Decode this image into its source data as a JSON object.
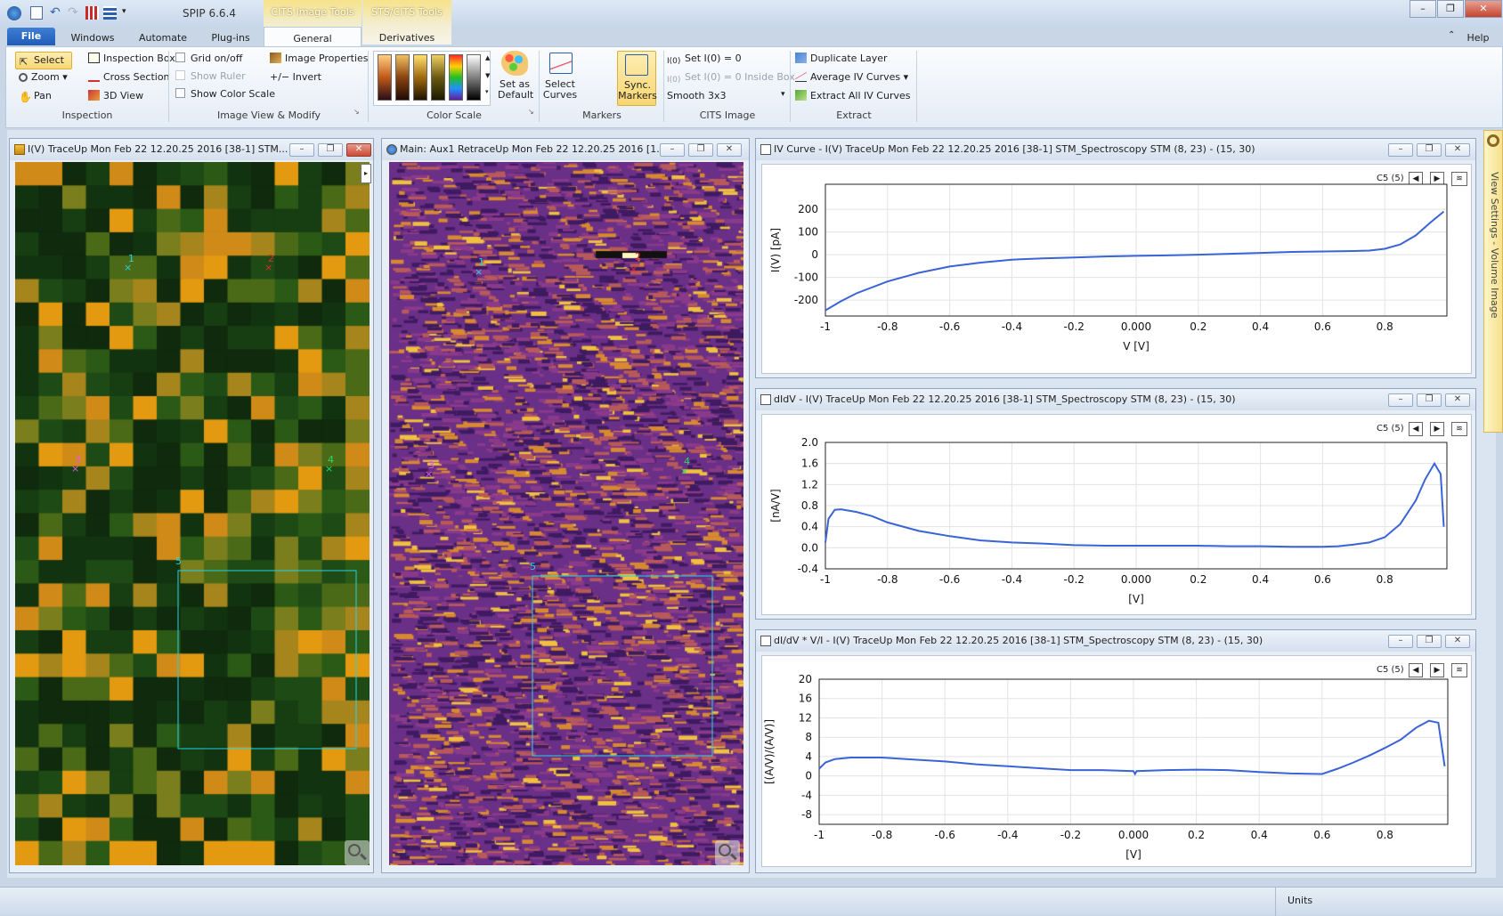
{
  "app": {
    "title": "SPIP 6.6.4"
  },
  "ribbon_tabs": {
    "file": "File",
    "windows": "Windows",
    "automate": "Automate",
    "plugins": "Plug-ins",
    "general": "General",
    "derivatives": "Derivatives",
    "ctx_cits": "CITS Image Tools",
    "ctx_sts": "STS/CITS Tools",
    "help": "Help"
  },
  "ribbon": {
    "inspection": {
      "select": "Select",
      "zoom": "Zoom",
      "pan": "Pan",
      "inspection_box": "Inspection Box",
      "cross_section": "Cross Section",
      "view_3d": "3D View",
      "label": "Inspection"
    },
    "image_view": {
      "grid": "Grid on/off",
      "ruler": "Show Ruler",
      "color_scale": "Show Color Scale",
      "image_properties": "Image Properties",
      "invert": "+/− Invert",
      "label": "Image View & Modify"
    },
    "color_scale_group": {
      "set_default": "Set as Default",
      "label": "Color Scale"
    },
    "markers": {
      "select_curves": "Select Curves",
      "sync_markers": "Sync. Markers",
      "label": "Markers"
    },
    "cits_image": {
      "set_i0": "Set I(0) = 0",
      "set_i0_box": "Set I(0) = 0 Inside Box",
      "smooth": "Smooth 3x3",
      "label": "CITS Image"
    },
    "extract": {
      "duplicate": "Duplicate Layer",
      "average": "Average IV Curves",
      "extract_all": "Extract All IV Curves",
      "label": "Extract"
    }
  },
  "colors": {
    "accent": "#1e5cb5",
    "ctx_yellow": "#f7e38a",
    "curve": "#3a63d6",
    "marker_cyan": "#22d3e6",
    "marker_red": "#e0262e",
    "marker_magenta": "#e35ce3",
    "marker_green": "#26d96a"
  },
  "panels": {
    "left": {
      "title": "I(V) TraceUp Mon Feb 22 12.20.25 2016 [38-1]  STM..."
    },
    "middle": {
      "title": "Main: Aux1 RetraceUp Mon Feb 22 12.20.25 2016 [1..."
    },
    "iv": {
      "title": "IV Curve - I(V) TraceUp Mon Feb 22 12.20.25 2016 [38-1]  STM_Spectroscopy STM (8, 23) - (15, 30)",
      "curve_sel": "C5 (5)"
    },
    "didv": {
      "title": "dIdV - I(V) TraceUp Mon Feb 22 12.20.25 2016 [38-1]  STM_Spectroscopy STM (8, 23) - (15, 30)",
      "curve_sel": "C5 (5)"
    },
    "norm": {
      "title": "dI/dV * V/I - I(V) TraceUp Mon Feb 22 12.20.25 2016 [38-1]  STM_Spectroscopy STM (8, 23) - (15, 30)",
      "curve_sel": "C5 (5)"
    }
  },
  "markers": {
    "m1": "1",
    "m2": "2",
    "m3": "3",
    "m4": "4",
    "m5": "5"
  },
  "side": {
    "view_settings": "View Settings - Volume Image"
  },
  "status": {
    "units": "Units"
  },
  "chart_data": [
    {
      "type": "line",
      "xlabel": "V [V]",
      "ylabel": "I(V) [pA]",
      "xlim": [
        -1,
        1
      ],
      "ylim": [
        -270,
        310
      ],
      "x_ticks": [
        "-1",
        "-0.8",
        "-0.6",
        "-0.4",
        "-0.2",
        "0.000",
        "0.2",
        "0.4",
        "0.6",
        "0.8"
      ],
      "y_ticks": [
        "200",
        "100",
        "0",
        "-100",
        "-200"
      ],
      "x": [
        -1,
        -0.95,
        -0.9,
        -0.8,
        -0.7,
        -0.6,
        -0.5,
        -0.4,
        -0.3,
        -0.2,
        -0.1,
        0,
        0.1,
        0.2,
        0.3,
        0.4,
        0.5,
        0.6,
        0.7,
        0.75,
        0.8,
        0.85,
        0.9,
        0.95,
        0.99
      ],
      "y": [
        -245,
        -205,
        -170,
        -118,
        -80,
        -52,
        -35,
        -22,
        -16,
        -12,
        -8,
        -5,
        -3,
        0,
        4,
        8,
        12,
        14,
        16,
        18,
        26,
        45,
        85,
        145,
        190
      ]
    },
    {
      "type": "line",
      "xlabel": "[V]",
      "ylabel": "[nA/V]",
      "xlim": [
        -1,
        1
      ],
      "ylim": [
        -0.4,
        2.0
      ],
      "x_ticks": [
        "-1",
        "-0.8",
        "-0.6",
        "-0.4",
        "-0.2",
        "0.000",
        "0.2",
        "0.4",
        "0.6",
        "0.8"
      ],
      "y_ticks": [
        "2.0",
        "1.6",
        "1.2",
        "0.8",
        "0.4",
        "0.0",
        "-0.4"
      ],
      "x": [
        -1,
        -0.99,
        -0.97,
        -0.95,
        -0.9,
        -0.85,
        -0.8,
        -0.7,
        -0.6,
        -0.5,
        -0.4,
        -0.3,
        -0.2,
        -0.1,
        0,
        0.1,
        0.2,
        0.3,
        0.4,
        0.5,
        0.6,
        0.65,
        0.7,
        0.75,
        0.8,
        0.85,
        0.9,
        0.93,
        0.96,
        0.98,
        0.99
      ],
      "y": [
        0.1,
        0.55,
        0.72,
        0.73,
        0.68,
        0.6,
        0.48,
        0.32,
        0.22,
        0.14,
        0.1,
        0.08,
        0.05,
        0.04,
        0.04,
        0.04,
        0.04,
        0.03,
        0.03,
        0.02,
        0.02,
        0.03,
        0.06,
        0.1,
        0.2,
        0.45,
        0.9,
        1.3,
        1.6,
        1.4,
        0.4
      ]
    },
    {
      "type": "line",
      "xlabel": "[V]",
      "ylabel": "[(A/V)/(A/V)]",
      "xlim": [
        -1,
        1
      ],
      "ylim": [
        -10,
        20
      ],
      "x_ticks": [
        "-1",
        "-0.8",
        "-0.6",
        "-0.4",
        "-0.2",
        "0.000",
        "0.2",
        "0.4",
        "0.6",
        "0.8"
      ],
      "y_ticks": [
        "20",
        "16",
        "12",
        "8",
        "4",
        "0",
        "-4",
        "-8"
      ],
      "x": [
        -1,
        -0.98,
        -0.95,
        -0.9,
        -0.8,
        -0.7,
        -0.6,
        -0.5,
        -0.4,
        -0.3,
        -0.2,
        -0.1,
        0,
        0.005,
        0.01,
        0.1,
        0.2,
        0.3,
        0.4,
        0.5,
        0.6,
        0.65,
        0.7,
        0.75,
        0.8,
        0.85,
        0.9,
        0.94,
        0.97,
        0.99
      ],
      "y": [
        1.5,
        2.8,
        3.5,
        3.8,
        3.8,
        3.4,
        3.0,
        2.4,
        2.0,
        1.6,
        1.2,
        1.2,
        1.0,
        0.4,
        1.0,
        1.2,
        1.3,
        1.2,
        0.8,
        0.5,
        0.4,
        1.5,
        2.8,
        4.2,
        5.8,
        7.5,
        10.0,
        11.4,
        11.0,
        2.0
      ]
    }
  ]
}
